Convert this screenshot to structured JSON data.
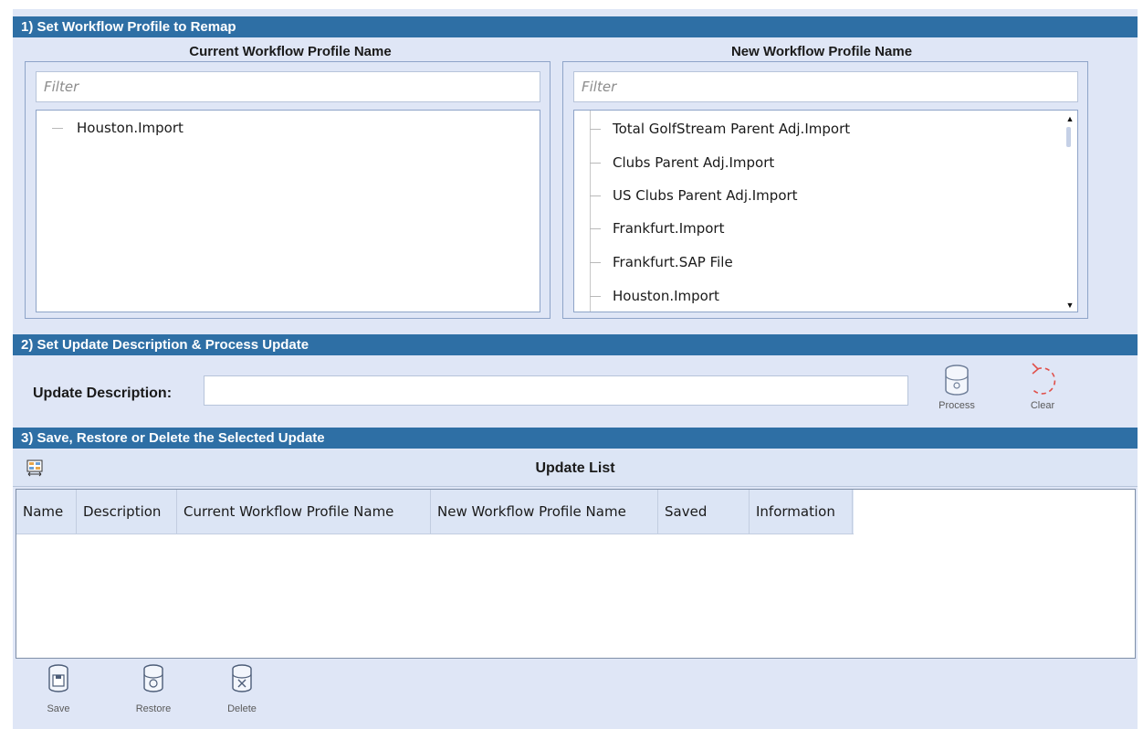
{
  "section1": {
    "title": "1) Set Workflow Profile to Remap",
    "current": {
      "title": "Current Workflow Profile Name",
      "filter_placeholder": "Filter",
      "items": [
        "Houston.Import"
      ]
    },
    "new": {
      "title": "New Workflow Profile Name",
      "filter_placeholder": "Filter",
      "items": [
        "Total GolfStream Parent Adj.Import",
        "Clubs Parent Adj.Import",
        "US Clubs Parent Adj.Import",
        "Frankfurt.Import",
        "Frankfurt.SAP File",
        "Houston.Import"
      ]
    }
  },
  "section2": {
    "title": "2) Set Update Description & Process Update",
    "desc_label": "Update Description:",
    "desc_value": "",
    "process_label": "Process",
    "clear_label": "Clear"
  },
  "section3": {
    "title": "3) Save, Restore or Delete the Selected Update",
    "list_title": "Update List",
    "columns": [
      "Name",
      "Description",
      "Current Workflow Profile Name",
      "New Workflow Profile Name",
      "Saved",
      "Information"
    ],
    "save_label": "Save",
    "restore_label": "Restore",
    "delete_label": "Delete"
  },
  "colors": {
    "header_bg": "#2e6fa5",
    "panel_bg": "#dfe6f6",
    "clear_icon": "#e0504a"
  },
  "icons": [
    "process-database-icon",
    "clear-undo-icon",
    "layout-grid-icon",
    "save-database-icon",
    "restore-database-icon",
    "delete-database-icon"
  ]
}
